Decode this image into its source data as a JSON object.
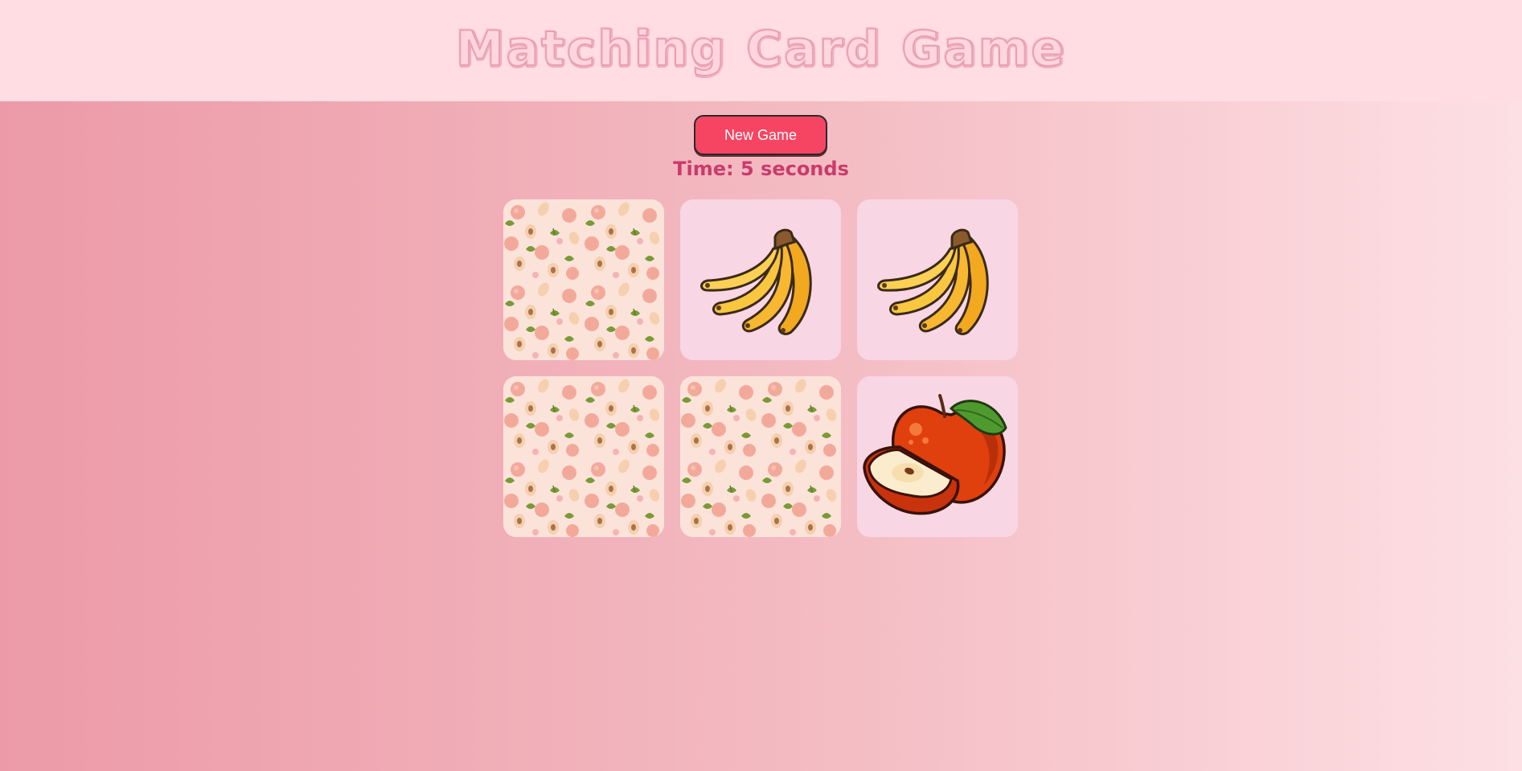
{
  "header": {
    "title": "Matching Card Game"
  },
  "controls": {
    "new_game_label": "New Game"
  },
  "status": {
    "timer_text": "Time: 5 seconds"
  },
  "board": {
    "cards": [
      {
        "state": "face-down",
        "icon": "peach-pattern-icon"
      },
      {
        "state": "face-up",
        "icon": "banana-icon"
      },
      {
        "state": "face-up",
        "icon": "banana-icon"
      },
      {
        "state": "face-down",
        "icon": "peach-pattern-icon"
      },
      {
        "state": "face-down",
        "icon": "peach-pattern-icon"
      },
      {
        "state": "face-up",
        "icon": "apple-icon"
      }
    ]
  },
  "colors": {
    "accent": "#f64562",
    "timer": "#c93b6c",
    "card_face": "#f9d6e3",
    "card_back": "#fbe3da"
  }
}
